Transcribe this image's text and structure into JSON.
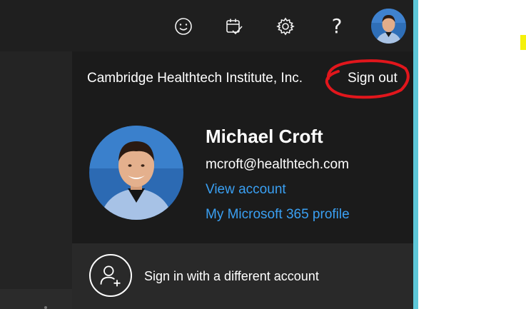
{
  "topbar": {
    "icons": [
      {
        "name": "smiley-icon",
        "label": "Feedback"
      },
      {
        "name": "calendar-check-icon",
        "label": "My Day"
      },
      {
        "name": "gear-icon",
        "label": "Settings"
      },
      {
        "name": "help-icon",
        "glyph": "?"
      }
    ],
    "avatar": "profile-photo"
  },
  "account_panel": {
    "org_name": "Cambridge Healthtech Institute, Inc.",
    "sign_out_label": "Sign out",
    "user_name": "Michael Croft",
    "user_email": "mcroft@healthtech.com",
    "view_account_label": "View account",
    "profile_link_label": "My Microsoft 365 profile",
    "switch_account_label": "Sign in with a different account"
  },
  "colors": {
    "background": "#1b1b1b",
    "link": "#3aa0f3",
    "accent_border": "#5ec7d8",
    "annotation_red": "#e1161c",
    "highlight_yellow": "#f5f10b"
  }
}
